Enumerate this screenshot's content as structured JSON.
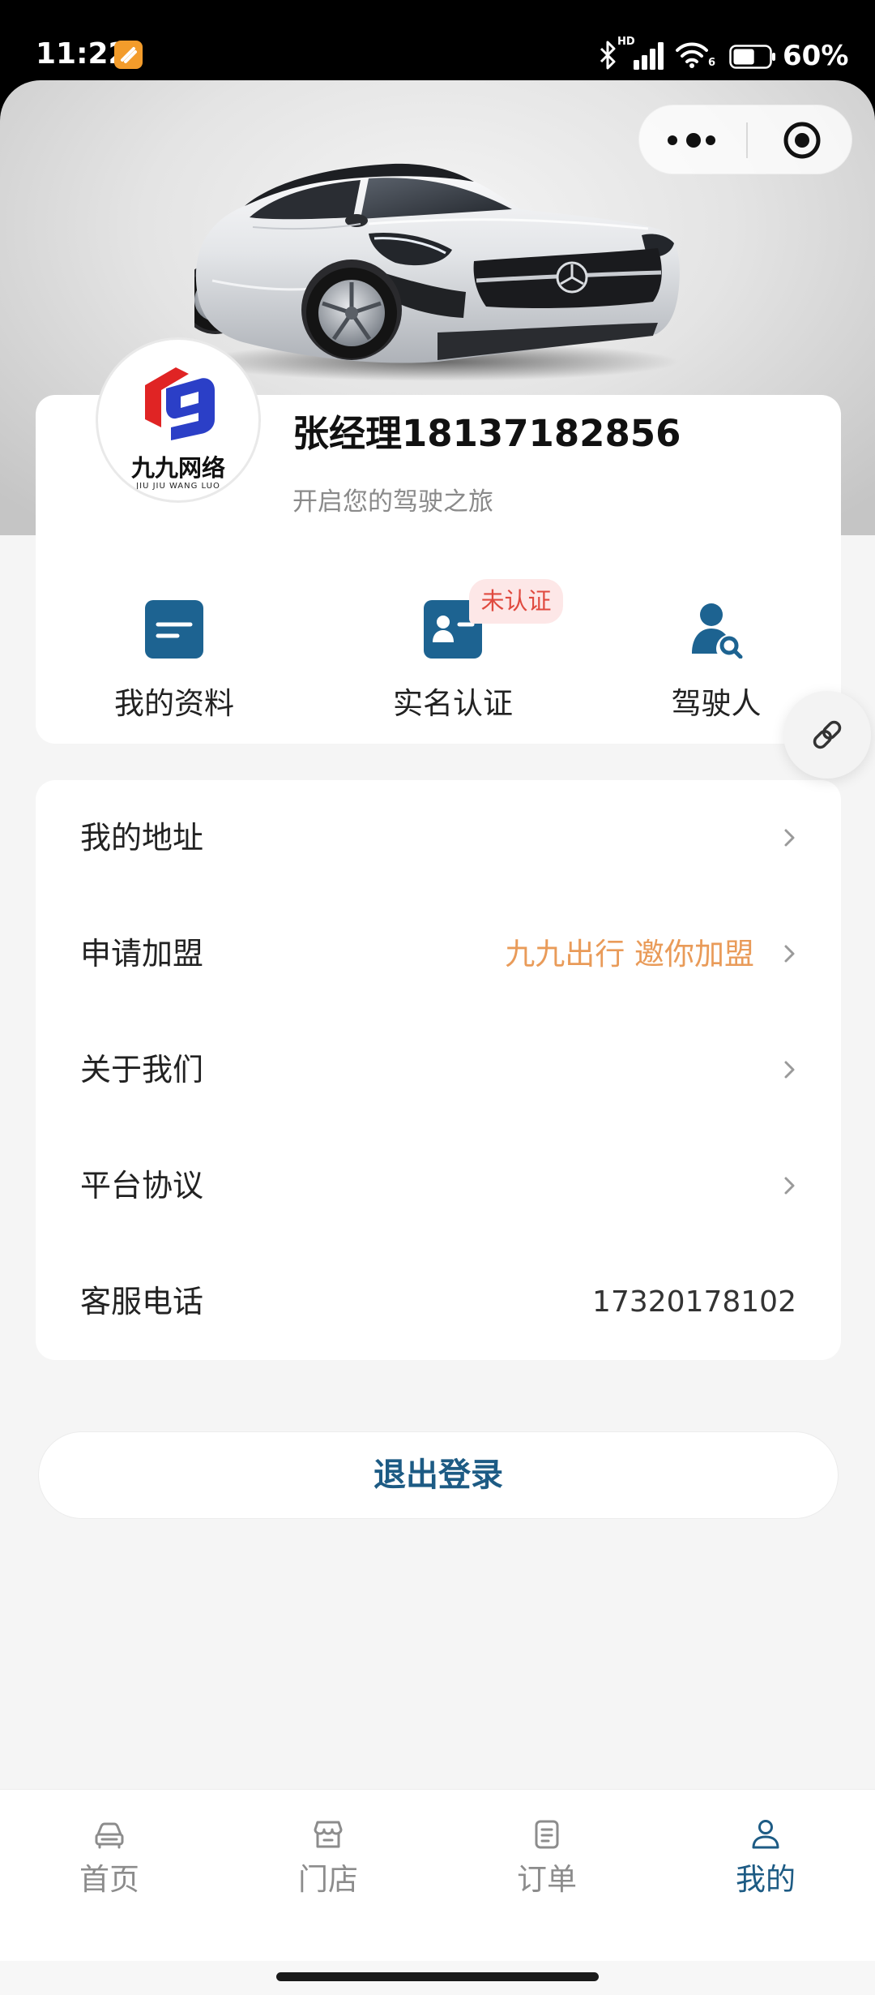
{
  "status_bar": {
    "time": "11:22",
    "network_label": "HD",
    "wifi_generation": "6",
    "battery_text": "60%",
    "battery_level": 0.6,
    "icons": [
      "app-notification-icon",
      "bluetooth-icon",
      "signal-icon",
      "wifi-icon",
      "battery-icon"
    ]
  },
  "capsule": {
    "icons": [
      "more-dots-icon",
      "close-target-icon"
    ]
  },
  "profile": {
    "logo": {
      "name_cn": "九九网络",
      "name_en": "JIU JIU WANG LUO"
    },
    "name": "张经理18137182856",
    "subtitle": "开启您的驾驶之旅",
    "actions": [
      {
        "label": "我的资料",
        "icon": "profile-document-icon"
      },
      {
        "label": "实名认证",
        "icon": "id-card-icon",
        "badge": "未认证"
      },
      {
        "label": "驾驶人",
        "icon": "driver-search-icon"
      }
    ]
  },
  "floating_button": {
    "icon": "link-icon"
  },
  "menu": [
    {
      "label": "我的地址"
    },
    {
      "label": "申请加盟",
      "value": "九九出行 邀你加盟"
    },
    {
      "label": "关于我们"
    },
    {
      "label": "平台协议"
    },
    {
      "label": "客服电话",
      "value": "17320178102"
    }
  ],
  "logout_label": "退出登录",
  "tabs": [
    {
      "label": "首页",
      "icon": "car-icon"
    },
    {
      "label": "门店",
      "icon": "store-icon"
    },
    {
      "label": "订单",
      "icon": "order-icon"
    },
    {
      "label": "我的",
      "icon": "user-icon",
      "active": true
    }
  ],
  "colors": {
    "accent": "#1d5b84",
    "icon_blue": "#1d6391",
    "promo_orange": "#e99b59",
    "badge_red": "#e04a3f",
    "badge_bg": "#fde7e7",
    "page_background": "#f5f5f5"
  }
}
